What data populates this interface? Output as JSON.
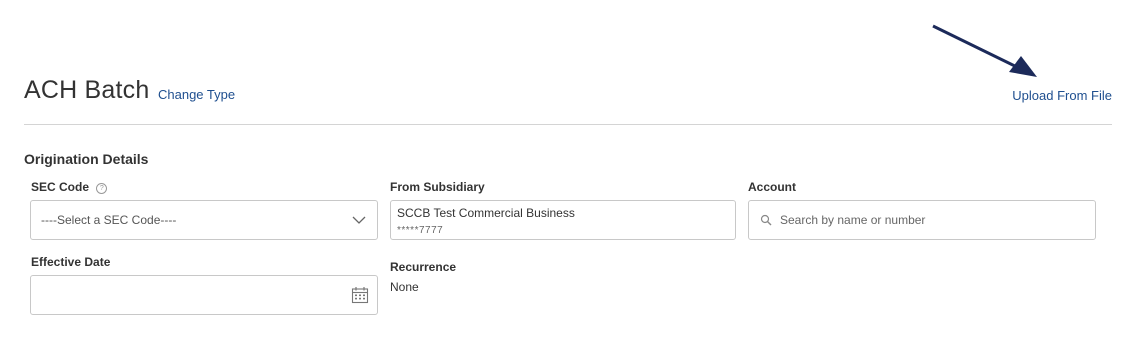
{
  "header": {
    "title": "ACH Batch",
    "change_type_label": "Change Type",
    "upload_label": "Upload From File"
  },
  "section": {
    "title": "Origination Details"
  },
  "fields": {
    "sec_code": {
      "label": "SEC Code",
      "value": "----Select a SEC Code----"
    },
    "from_subsidiary": {
      "label": "From Subsidiary",
      "name": "SCCB Test Commercial Business",
      "account_masked": "*****7777"
    },
    "account": {
      "label": "Account",
      "placeholder": "Search by name or number"
    },
    "effective_date": {
      "label": "Effective Date",
      "value": ""
    },
    "recurrence": {
      "label": "Recurrence",
      "value": "None"
    }
  },
  "icons": {
    "help": "help-circle-icon",
    "chevron": "chevron-down-icon",
    "search": "search-icon",
    "calendar": "calendar-icon",
    "arrow": "annotation-arrow-icon"
  },
  "colors": {
    "link": "#1f4f8f",
    "arrow": "#1c2a5a",
    "border": "#c8c8c8"
  }
}
